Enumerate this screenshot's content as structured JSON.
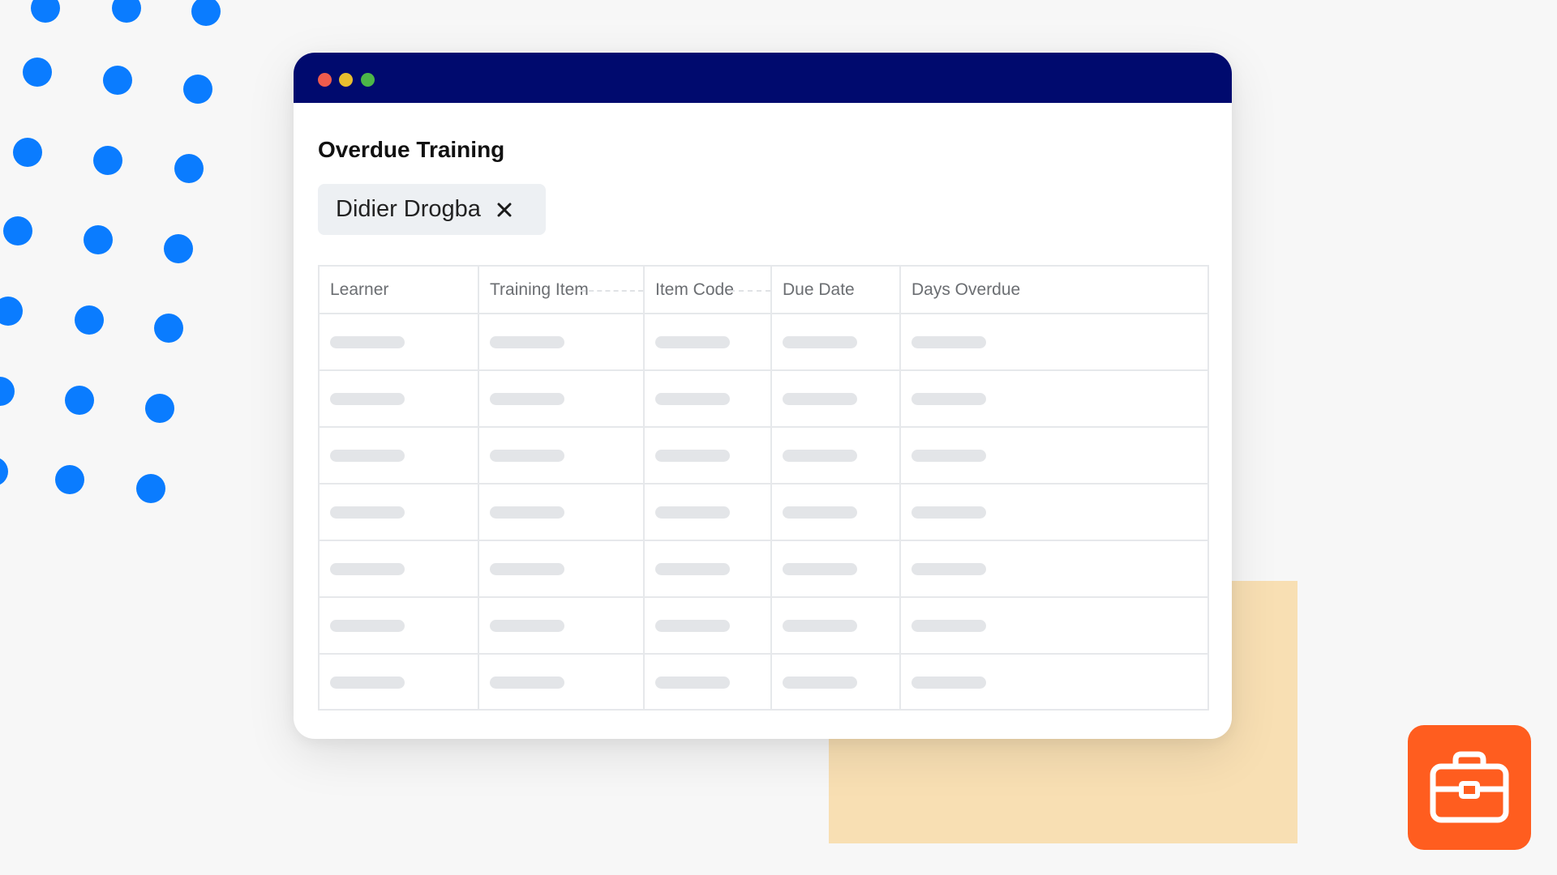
{
  "panel": {
    "title": "Overdue Training",
    "filter_chip": {
      "label": "Didier Drogba",
      "remove_icon": "close-icon"
    }
  },
  "table": {
    "columns": [
      "Learner",
      "Training Item",
      "Item Code",
      "Due Date",
      "Days Overdue"
    ],
    "row_count": 7,
    "rows_state": "loading-placeholder"
  },
  "badge": {
    "icon": "briefcase-icon"
  },
  "colors": {
    "background": "#f7f7f7",
    "titlebar": "#000a6e",
    "dots": "#0a7cff",
    "peach": "#f8dfb3",
    "badge": "#ff5d1f",
    "chip": "#edf0f3",
    "traffic_red": "#ee5b4d",
    "traffic_yellow": "#e8be2f",
    "traffic_green": "#4cb648"
  }
}
